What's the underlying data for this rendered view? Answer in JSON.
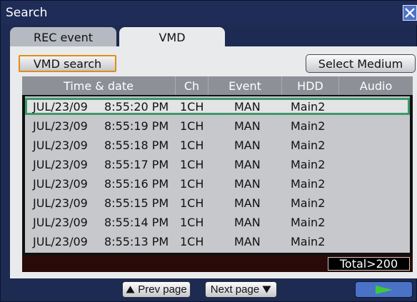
{
  "window": {
    "title": "Search"
  },
  "tabs": [
    {
      "label": "REC event",
      "active": false
    },
    {
      "label": "VMD",
      "active": true
    }
  ],
  "toolbar": {
    "vmd_search_label": "VMD search",
    "select_medium_label": "Select Medium"
  },
  "table": {
    "headers": {
      "time_date": "Time & date",
      "ch": "Ch",
      "event": "Event",
      "hdd": "HDD",
      "audio": "Audio"
    },
    "rows": [
      {
        "date": "JUL/23/09",
        "time": "8:55:20 PM",
        "ch": "1CH",
        "event": "MAN",
        "hdd": "Main2",
        "audio": "",
        "selected": true
      },
      {
        "date": "JUL/23/09",
        "time": "8:55:19 PM",
        "ch": "1CH",
        "event": "MAN",
        "hdd": "Main2",
        "audio": ""
      },
      {
        "date": "JUL/23/09",
        "time": "8:55:18 PM",
        "ch": "1CH",
        "event": "MAN",
        "hdd": "Main2",
        "audio": ""
      },
      {
        "date": "JUL/23/09",
        "time": "8:55:17 PM",
        "ch": "1CH",
        "event": "MAN",
        "hdd": "Main2",
        "audio": ""
      },
      {
        "date": "JUL/23/09",
        "time": "8:55:16 PM",
        "ch": "1CH",
        "event": "MAN",
        "hdd": "Main2",
        "audio": ""
      },
      {
        "date": "JUL/23/09",
        "time": "8:55:15 PM",
        "ch": "1CH",
        "event": "MAN",
        "hdd": "Main2",
        "audio": ""
      },
      {
        "date": "JUL/23/09",
        "time": "8:55:14 PM",
        "ch": "1CH",
        "event": "MAN",
        "hdd": "Main2",
        "audio": ""
      },
      {
        "date": "JUL/23/09",
        "time": "8:55:13 PM",
        "ch": "1CH",
        "event": "MAN",
        "hdd": "Main2",
        "audio": ""
      }
    ],
    "total_label": "Total>200"
  },
  "pager": {
    "prev_label": "Prev page",
    "next_label": "Next page"
  },
  "icons": {
    "close": "close-icon",
    "prev": "triangle-up-icon",
    "next": "triangle-down-icon",
    "play": "play-icon"
  },
  "colors": {
    "accent_orange": "#e38b1a",
    "selection_green": "#3d9a6a",
    "play_green": "#3fc83a",
    "window_blue": "#1f2c57"
  }
}
